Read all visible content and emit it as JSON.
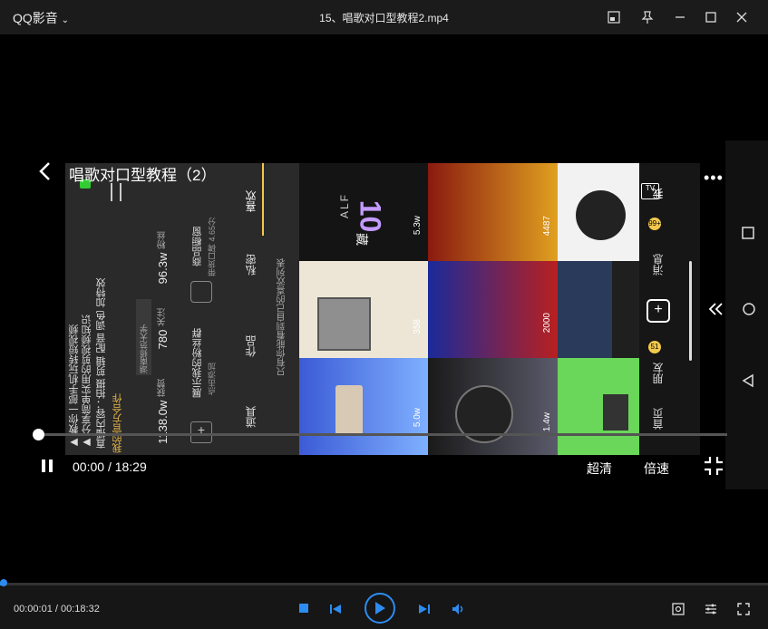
{
  "app": {
    "brand": "QQ影音",
    "file_title": "15、唱歌对口型教程2.mp4"
  },
  "overlay": {
    "title": "唱歌对口型教程（2）"
  },
  "player": {
    "current": "00:00",
    "sep": "/",
    "total": "18:29",
    "quality": "超清",
    "speed": "倍速"
  },
  "statusbar": {
    "time_current": "00:00:01",
    "time_total": "00:18:32"
  },
  "phone": {
    "profile_lines": [
      "▶ 教你一部手机玩转短视频",
      "▶ 分享简单实用的剪视频知识",
      "直播内容：拍摄 剪辑 配音 调色 加特效",
      "我的官方合作"
    ],
    "stats": {
      "likes": "1138.0w",
      "likes_label": "获赞",
      "follow": "780",
      "follow_label": "关注",
      "fans": "96.3w",
      "fans_label": "粉丝"
    },
    "fans_group": "展示我的粉丝群",
    "fans_group_sub": "点击添加",
    "shop": "商品橱窗",
    "shop_sub": "带货口碑 4.65分",
    "tag": "湖南师范大学",
    "tabs": [
      "作品",
      "私密",
      "喜欢",
      "道具"
    ],
    "hint": "只有你能看到自己的喜欢列表",
    "nav": [
      "首页",
      "朋友",
      "消息",
      "我"
    ],
    "nav_badges": {
      "friends": "51",
      "messages": "99+"
    },
    "banner": "ALF",
    "banner_big": "10",
    "banner_sub": "藏",
    "counts": [
      "5.3w",
      "4487",
      "358",
      "2000",
      "5.0w",
      "1.4w"
    ]
  },
  "colors": {
    "accent": "#2d8cf0",
    "gold": "#f2c94c"
  }
}
